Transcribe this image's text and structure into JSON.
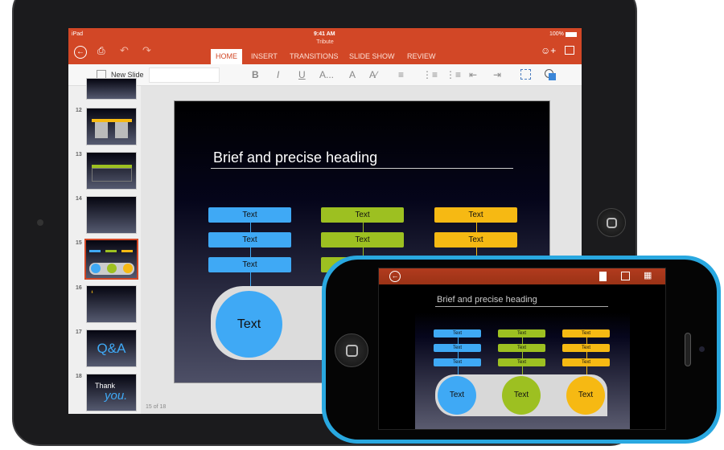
{
  "ipad": {
    "status": {
      "carrier": "iPad",
      "time": "9:41 AM",
      "battery": "100%"
    },
    "document_title": "Tribute",
    "tabs": [
      {
        "label": "HOME",
        "active": true
      },
      {
        "label": "INSERT"
      },
      {
        "label": "TRANSITIONS"
      },
      {
        "label": "SLIDE SHOW"
      },
      {
        "label": "REVIEW"
      }
    ],
    "ribbon": {
      "new_slide": "New Slide",
      "bold": "B",
      "italic": "I",
      "underline": "U",
      "font_more": "A...",
      "font_color": "A"
    },
    "thumbnails": [
      {
        "number": "12"
      },
      {
        "number": "13"
      },
      {
        "number": "14"
      },
      {
        "number": "15",
        "selected": true
      },
      {
        "number": "16"
      },
      {
        "number": "17",
        "text": "Q&A"
      },
      {
        "number": "18",
        "text1": "Thank",
        "text2": "you."
      }
    ],
    "slide_counter": "15 of 18",
    "slide": {
      "heading": "Brief and precise heading",
      "box_label": "Text",
      "circle_label": "Text"
    }
  },
  "iphone": {
    "slide": {
      "heading": "Brief and precise heading",
      "box_label": "Text",
      "circle_label": "Text"
    }
  },
  "colors": {
    "accent": "#d24726",
    "blue": "#3fa9f5",
    "green": "#9dc021",
    "yellow": "#f6b913",
    "phone_body": "#29a8e0"
  }
}
